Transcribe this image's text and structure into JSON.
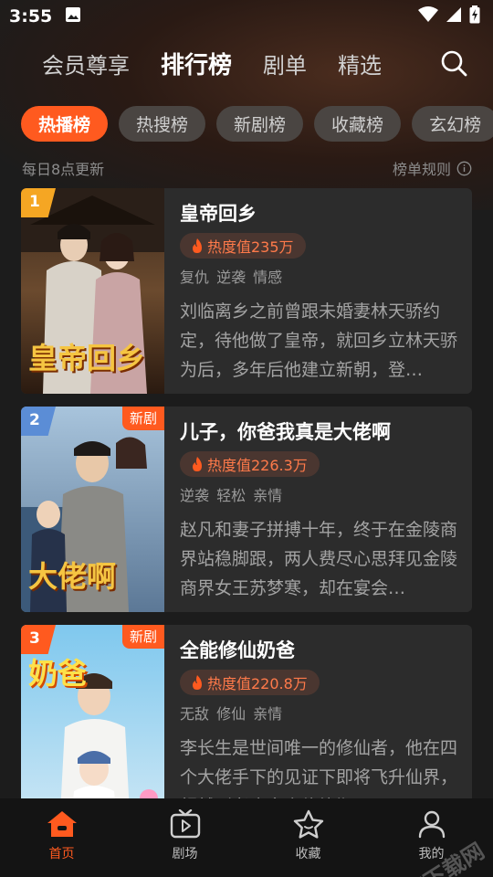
{
  "status": {
    "time": "3:55"
  },
  "top_tabs": [
    {
      "label": "会员尊享",
      "active": false
    },
    {
      "label": "排行榜",
      "active": true
    },
    {
      "label": "剧单",
      "active": false
    },
    {
      "label": "精选",
      "active": false
    }
  ],
  "chips": [
    {
      "label": "热播榜",
      "active": true
    },
    {
      "label": "热搜榜",
      "active": false
    },
    {
      "label": "新剧榜",
      "active": false
    },
    {
      "label": "收藏榜",
      "active": false
    },
    {
      "label": "玄幻榜",
      "active": false
    }
  ],
  "update_note": "每日8点更新",
  "rules_label": "榜单规则",
  "dramas": [
    {
      "rank": "1",
      "badge": "",
      "title": "皇帝回乡",
      "heat": "热度值235万",
      "tags": "复仇 逆袭 情感",
      "desc": "刘临离乡之前曾跟未婚妻林天骄约定，待他做了皇帝，就回乡立林天骄为后，多年后他建立新朝，登…",
      "poster_text": "皇帝回乡"
    },
    {
      "rank": "2",
      "badge": "新剧",
      "title": "儿子，你爸我真是大佬啊",
      "heat": "热度值226.3万",
      "tags": "逆袭 轻松 亲情",
      "desc": "赵凡和妻子拼搏十年，终于在金陵商界站稳脚跟，两人费尽心思拜见金陵商界女王苏梦寒，却在宴会…",
      "poster_text": "大佬啊"
    },
    {
      "rank": "3",
      "badge": "新剧",
      "title": "全能修仙奶爸",
      "heat": "热度值220.8万",
      "tags": "无敌 修仙 亲情",
      "desc": "李长生是世间唯一的修仙者，他在四个大佬手下的见证下即将飞升仙界，超越到老也多次修炼期…",
      "poster_text": "奶爸"
    }
  ],
  "bottom_nav": [
    {
      "label": "首页",
      "active": true
    },
    {
      "label": "剧场",
      "active": false
    },
    {
      "label": "收藏",
      "active": false
    },
    {
      "label": "我的",
      "active": false
    }
  ],
  "watermark": "光速下载网",
  "colors": {
    "accent": "#ff5a1f",
    "rank1": "#f5a623",
    "rank2": "#5b8dd6",
    "rank3": "#ff5a1f"
  }
}
